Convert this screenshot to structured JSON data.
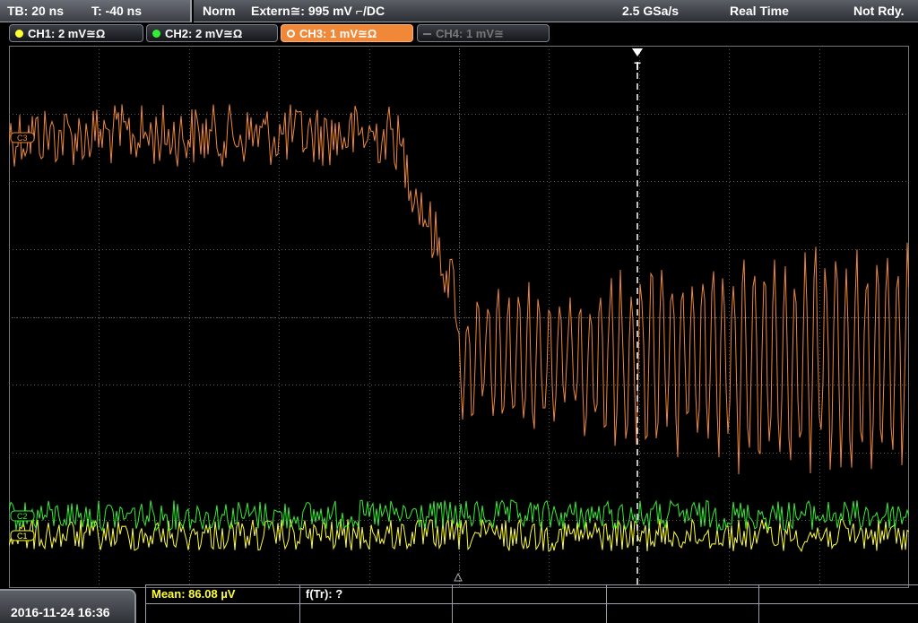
{
  "top": {
    "timebase": "TB: 20 ns",
    "trigger_pos": "T: -40 ns",
    "mode": "Norm",
    "trigger_source": "Extern≅: 995 mV ⌐/DC",
    "sample_rate": "2.5 GSa/s",
    "acq_mode": "Real Time",
    "status": "Not Rdy."
  },
  "channels": [
    {
      "label": "CH1: 2 mV≅Ω",
      "color": "#ffff33"
    },
    {
      "label": "CH2: 2 mV≅Ω",
      "color": "#33ee33"
    },
    {
      "label": "CH3: 1 mV≅Ω",
      "color": "#f08838"
    },
    {
      "label": "CH4: 1 mV≅",
      "color": "#777777"
    }
  ],
  "screen": {
    "marker_ch3": "C3",
    "marker_ch2": "C2",
    "marker_ch1": "C1",
    "trigger_marker": "T"
  },
  "bottom": {
    "datetime": "2016-11-24 16:36",
    "meas1": "Mean: 86.08 µV",
    "meas2": "f(Tr): ?"
  },
  "colors": {
    "ch1": "#ffff33",
    "ch2": "#33ee33",
    "ch3": "#f08838",
    "grid": "#5a5a5a",
    "meas_highlight": "#ffff33"
  }
}
